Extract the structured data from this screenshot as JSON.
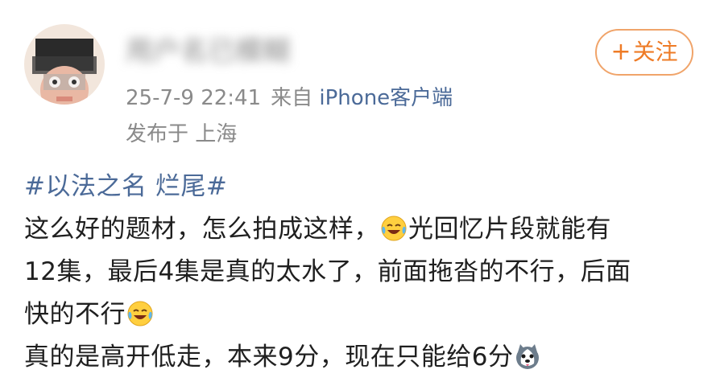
{
  "post": {
    "username": "用户名已模糊",
    "time": "25-7-9 22:41",
    "source_prefix": "来自",
    "source": "iPhone客户端",
    "location": "发布于 上海",
    "follow_label": "关注",
    "follow_icon": "plus-icon",
    "hashtag": "#以法之名 烂尾#",
    "line1_a": "这么好的题材，怎么拍成这样，",
    "line1_b": "光回忆片段就能有",
    "line2": "12集，最后4集是真的太水了，前面拖沓的不行，后面",
    "line3": "快的不行",
    "line4": "真的是高开低走，本来9分，现在只能给6分",
    "emoji_laugh_cry": "laugh-cry-emoji",
    "emoji_husky": "husky-emoji"
  },
  "colors": {
    "link": "#4b6a98",
    "follow": "#ee7b26",
    "meta": "#8a8a8a",
    "text": "#1f1f1f"
  }
}
